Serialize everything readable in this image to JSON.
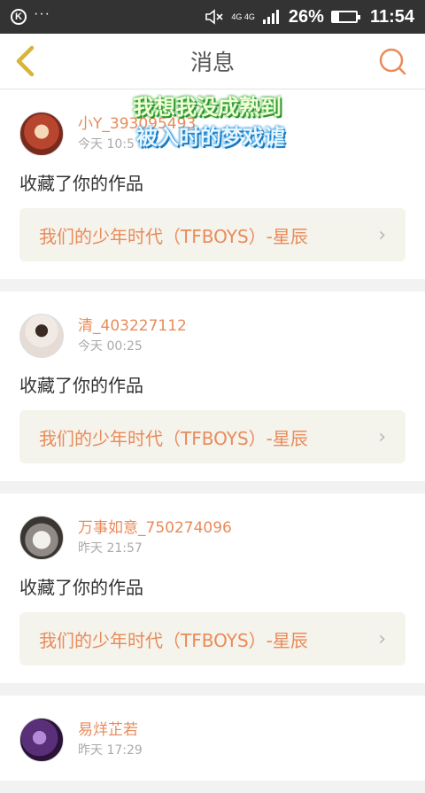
{
  "status_bar": {
    "network": "4G 4G",
    "battery_percent": "26%",
    "battery_level": 0.26,
    "time": "11:54"
  },
  "header": {
    "title": "消息"
  },
  "overlay": {
    "line1": "我想我没成熟到",
    "line2": "被入时的梦戏谑"
  },
  "messages": [
    {
      "username": "小Y_393095493",
      "time": "今天 10:5",
      "action": "收藏了你的作品",
      "work_title": "我们的少年时代（TFBOYS）-星辰"
    },
    {
      "username": "清_403227112",
      "time": "今天 00:25",
      "action": "收藏了你的作品",
      "work_title": "我们的少年时代（TFBOYS）-星辰"
    },
    {
      "username": "万事如意_750274096",
      "time": "昨天 21:57",
      "action": "收藏了你的作品",
      "work_title": "我们的少年时代（TFBOYS）-星辰"
    },
    {
      "username": "易烊芷若",
      "time": "昨天 17:29"
    }
  ],
  "colors": {
    "accent": "#e98b5a",
    "back_arrow": "#d9b43a",
    "status_bar_bg": "#333333"
  }
}
